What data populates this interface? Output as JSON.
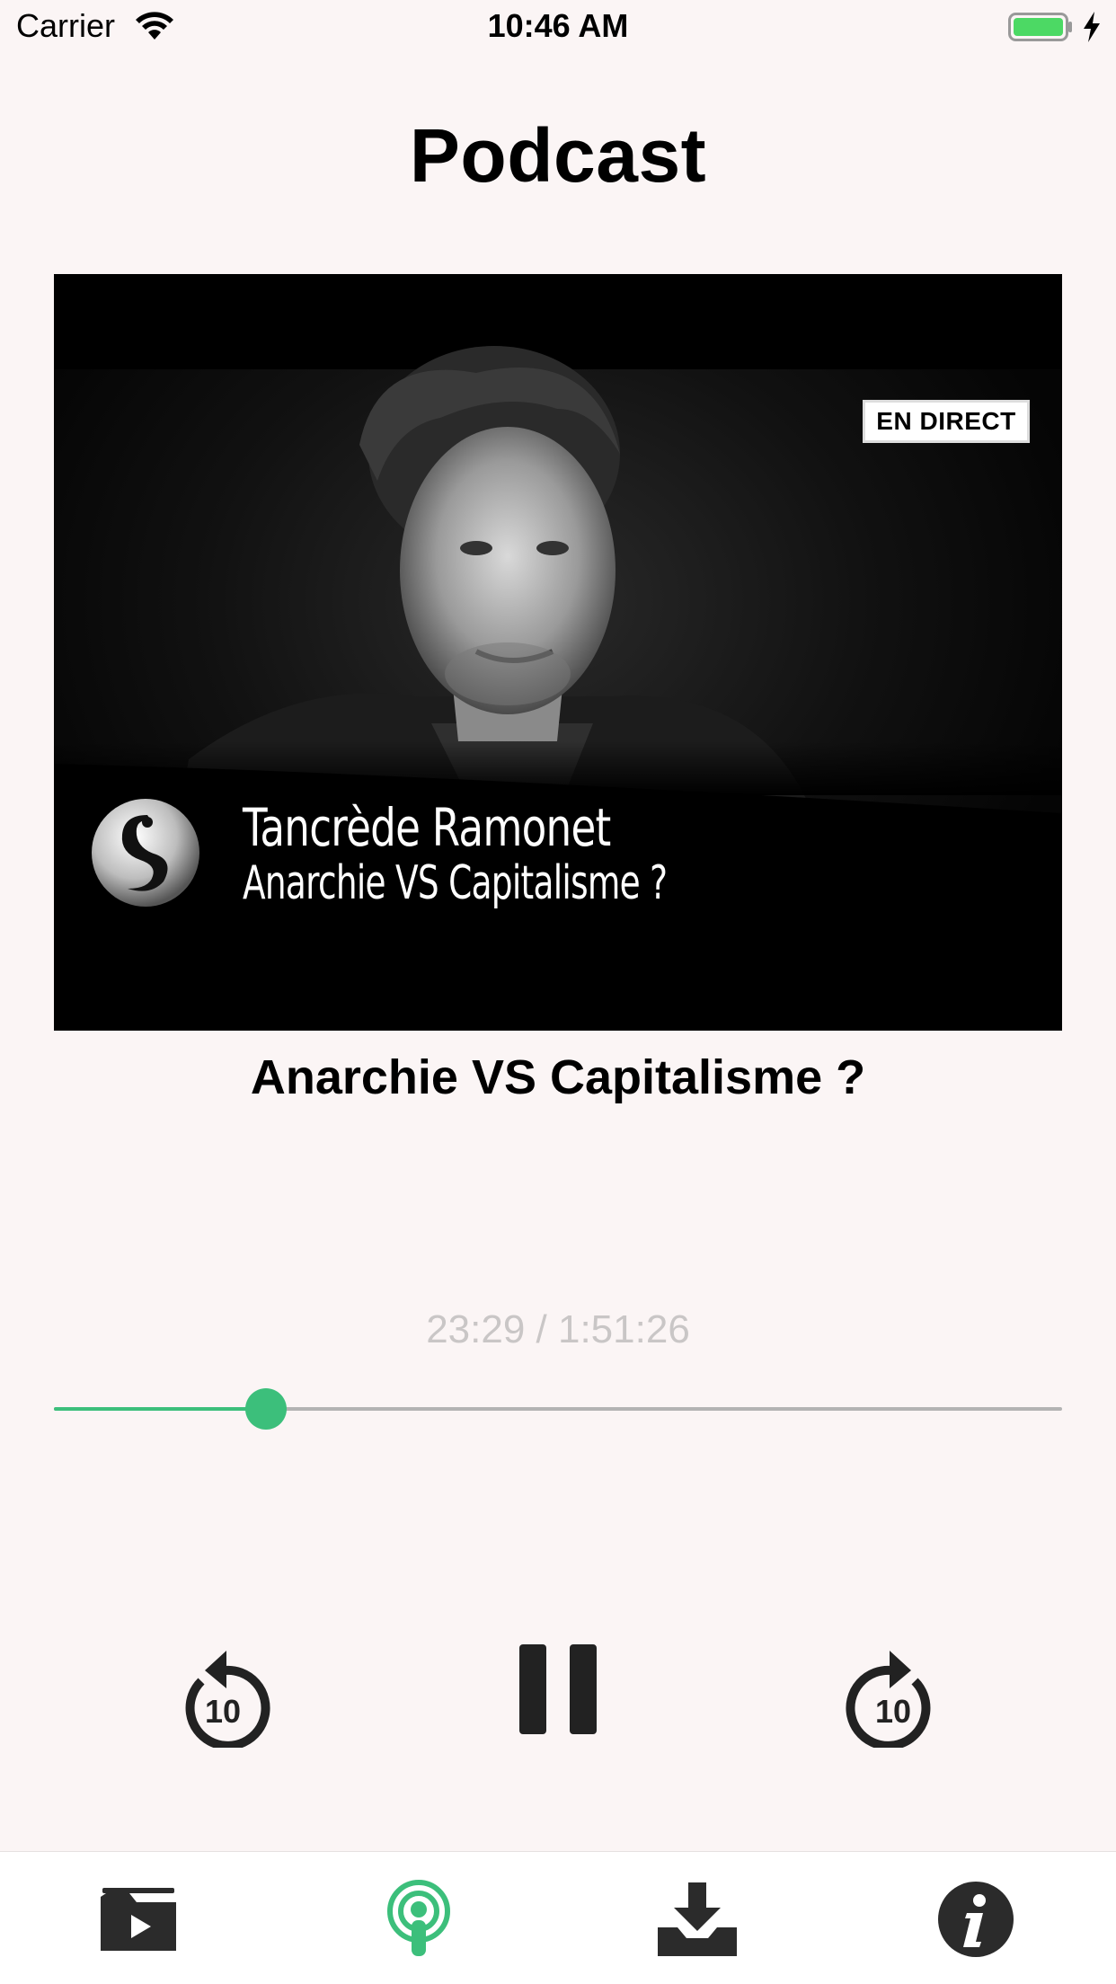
{
  "status_bar": {
    "carrier": "Carrier",
    "time": "10:46 AM",
    "battery_color": "#4cd964"
  },
  "header": {
    "title": "Podcast"
  },
  "episode": {
    "thumbnail": {
      "badge": "EN DIRECT",
      "name": "Tancrède Ramonet",
      "subtitle": "Anarchie VS Capitalisme ?"
    },
    "title": "Anarchie VS Capitalisme ?"
  },
  "player": {
    "time_readout": "23:29 / 1:51:26",
    "progress_fraction": 0.2107,
    "accent_color": "#3cbf7b",
    "controls": {
      "rewind_icon": "rewind-10-icon",
      "rewind_label": "10",
      "pause_icon": "pause-icon",
      "forward_icon": "forward-10-icon",
      "forward_label": "10"
    }
  },
  "tab_bar": {
    "items": [
      {
        "icon": "video-folder-icon",
        "active": false
      },
      {
        "icon": "podcast-icon",
        "active": true
      },
      {
        "icon": "download-icon",
        "active": false
      },
      {
        "icon": "info-icon",
        "active": false
      }
    ]
  }
}
